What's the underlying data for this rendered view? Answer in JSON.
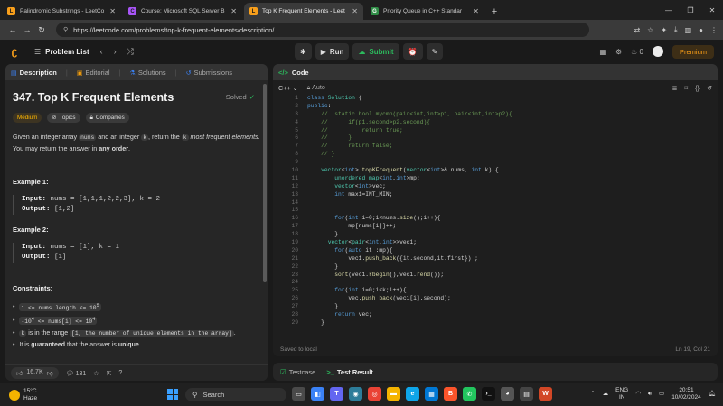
{
  "browser": {
    "tabs": [
      {
        "label": "Palindromic Substrings - LeetCo",
        "color": "#f89f1b",
        "glyph": "L",
        "active": false
      },
      {
        "label": "Course: Microsoft SQL Server B",
        "color": "#a855f7",
        "glyph": "C",
        "active": false
      },
      {
        "label": "Top K Frequent Elements - Leet",
        "color": "#f89f1b",
        "glyph": "L",
        "active": true
      },
      {
        "label": "Priority Queue in C++ Standar",
        "color": "#2f8d46",
        "glyph": "G",
        "active": false
      }
    ],
    "url": "https://leetcode.com/problems/top-k-frequent-elements/description/"
  },
  "lcnav": {
    "problem_list": "Problem List",
    "run": "Run",
    "submit": "Submit",
    "coins": "0",
    "premium": "Premium"
  },
  "left": {
    "tabs": {
      "description": "Description",
      "editorial": "Editorial",
      "solutions": "Solutions",
      "submissions": "Submissions"
    },
    "title": "347. Top K Frequent Elements",
    "solved": "Solved",
    "tags": {
      "difficulty": "Medium",
      "topics": "Topics",
      "companies": "Companies"
    },
    "statement": {
      "p1": "Given an integer array",
      "nums": "nums",
      "p2": "and an integer",
      "k": "k",
      "p3": ", return the",
      "k2": "k",
      "p4": "most frequent",
      "p5": "elements",
      "p6": ". You may return the answer in",
      "p7": "any order",
      "p8": "."
    },
    "example1": {
      "title": "Example 1:",
      "input_label": "Input:",
      "input": "nums = [1,1,1,2,2,3], k = 2",
      "output_label": "Output:",
      "output": "[1,2]"
    },
    "example2": {
      "title": "Example 2:",
      "input_label": "Input:",
      "input": "nums = [1], k = 1",
      "output_label": "Output:",
      "output": "[1]"
    },
    "constraints": {
      "title": "Constraints:",
      "c1": "1 <= nums.length <= 10",
      "c1_sup": "5",
      "c2a": "-10",
      "c2a_sup": "4",
      "c2b": " <= nums[i] <= 10",
      "c2b_sup": "4",
      "c3_k": "k",
      "c3_mid": "is in the range",
      "c3_range": "[1, the number of unique elements in the array]",
      "c3_end": ".",
      "c4a": "It is",
      "c4b": "guaranteed",
      "c4c": "that the answer is",
      "c4d": "unique",
      "c4e": "."
    },
    "footer": {
      "likes": "16.7K",
      "comments": "131"
    }
  },
  "right": {
    "header": "Code",
    "lang": "C++",
    "mode": "Auto",
    "status": "Saved to local",
    "position": "Ln 19, Col 21"
  },
  "code_lines": [
    {
      "n": "1",
      "t": "class Solution {"
    },
    {
      "n": "2",
      "t": "public:"
    },
    {
      "n": "3",
      "t": "    //  static bool mycmp(pair<int,int>p1, pair<int,int>p2){"
    },
    {
      "n": "4",
      "t": "    //      if(p1.second>p2.second){"
    },
    {
      "n": "5",
      "t": "    //          return true;"
    },
    {
      "n": "6",
      "t": "    //      }"
    },
    {
      "n": "7",
      "t": "    //      return false;"
    },
    {
      "n": "8",
      "t": "    // }"
    },
    {
      "n": "9",
      "t": ""
    },
    {
      "n": "10",
      "t": "    vector<int> topKFrequent(vector<int>& nums, int k) {"
    },
    {
      "n": "11",
      "t": "        unordered_map<int,int>mp;"
    },
    {
      "n": "12",
      "t": "        vector<int>vec;"
    },
    {
      "n": "13",
      "t": "        int max1=INT_MIN;"
    },
    {
      "n": "14",
      "t": ""
    },
    {
      "n": "15",
      "t": ""
    },
    {
      "n": "16",
      "t": "        for(int i=0;i<nums.size();i++){"
    },
    {
      "n": "17",
      "t": "            mp[nums[i]]++;"
    },
    {
      "n": "18",
      "t": "        }"
    },
    {
      "n": "19",
      "t": "      vector<pair<int,int>>vec1;"
    },
    {
      "n": "20",
      "t": "        for(auto it :mp){"
    },
    {
      "n": "21",
      "t": "            vec1.push_back({it.second,it.first}) ;"
    },
    {
      "n": "22",
      "t": "        }"
    },
    {
      "n": "23",
      "t": "        sort(vec1.rbegin(),vec1.rend());"
    },
    {
      "n": "24",
      "t": ""
    },
    {
      "n": "25",
      "t": "        for(int i=0;i<k;i++){"
    },
    {
      "n": "26",
      "t": "            vec.push_back(vec1[i].second);"
    },
    {
      "n": "27",
      "t": "        }"
    },
    {
      "n": "28",
      "t": "        return vec;"
    },
    {
      "n": "29",
      "t": "    }"
    }
  ],
  "bottom": {
    "testcase": "Testcase",
    "result": "Test Result"
  },
  "taskbar": {
    "temp": "15°C",
    "weather": "Haze",
    "search": "Search",
    "lang1": "ENG",
    "lang2": "IN",
    "time": "20:51",
    "date": "10/02/2024"
  }
}
